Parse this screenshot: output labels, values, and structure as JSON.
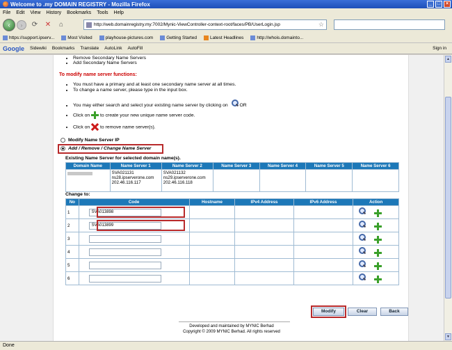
{
  "window": {
    "title": "Welcome to .my DOMAIN REGISTRY - Mozilla Firefox"
  },
  "menu": [
    "File",
    "Edit",
    "View",
    "History",
    "Bookmarks",
    "Tools",
    "Help"
  ],
  "nav": {
    "url": "http://web.domainregistry.my:7002/Mynic-ViewController-context-root/faces/PB/UserLogin.jsp"
  },
  "bookmarks": [
    "https://support.ipserv...",
    "Most Visited",
    "playhouse-pictures.com",
    "Getting Started",
    "Latest Headlines",
    "http://whois.domainto..."
  ],
  "google_toolbar": {
    "logo": "Google",
    "items": [
      "Sidewiki",
      "Bookmarks",
      "Translate",
      "AutoLink",
      "AutoFill"
    ],
    "signin": "Sign in"
  },
  "instructions": {
    "list_top": [
      "Remove Secondary Name Servers",
      "Add Secondary Name Servers"
    ],
    "heading": "To modify name server functions:",
    "line1": "You must have a primary and at least one secondary name server at all times.",
    "line2": "To change a name server, please type in the input box.",
    "line3": "You may either search and select your existing name server by clicking on",
    "line3_or": "OR",
    "line4_pre": "Click on",
    "line4_post": "to create your new unique name server code.",
    "line5_pre": "Click on",
    "line5_post": "to remove name server(s)."
  },
  "options": {
    "modify_ip": "Modify Name Server IP",
    "add_remove": "Add / Remove / Change Name Server"
  },
  "existing": {
    "title": "Existing Name Server for selected domain name(s).",
    "headers": [
      "Domain Name",
      "Name Server 1",
      "Name Server 2",
      "Name Server 3",
      "Name Server 4",
      "Name Server 5",
      "Name Server 6"
    ],
    "row": {
      "domain": "",
      "ns1_code": "SVA021131",
      "ns1_host": "ns28.ipserverone.com",
      "ns1_ip": "202.46.116.117",
      "ns2_code": "SVA021132",
      "ns2_host": "ns29.ipserverone.com",
      "ns2_ip": "202.46.116.118"
    }
  },
  "change": {
    "title": "Change to:",
    "headers": [
      "No",
      "Code",
      "Hostname",
      "IPv4 Address",
      "IPv6 Address",
      "Action"
    ],
    "rows": [
      {
        "no": "1",
        "code": "SVA013898"
      },
      {
        "no": "2",
        "code": "SVA013899"
      },
      {
        "no": "3",
        "code": ""
      },
      {
        "no": "4",
        "code": ""
      },
      {
        "no": "5",
        "code": ""
      },
      {
        "no": "6",
        "code": ""
      }
    ]
  },
  "buttons": {
    "modify": "Modify",
    "clear": "Clear",
    "back": "Back"
  },
  "footer": {
    "line1": "Developed and maintained by MYNIC Berhad",
    "line2": "Copyright © 2009 MYNIC Berhad. All rights reserved"
  },
  "status": "Done"
}
